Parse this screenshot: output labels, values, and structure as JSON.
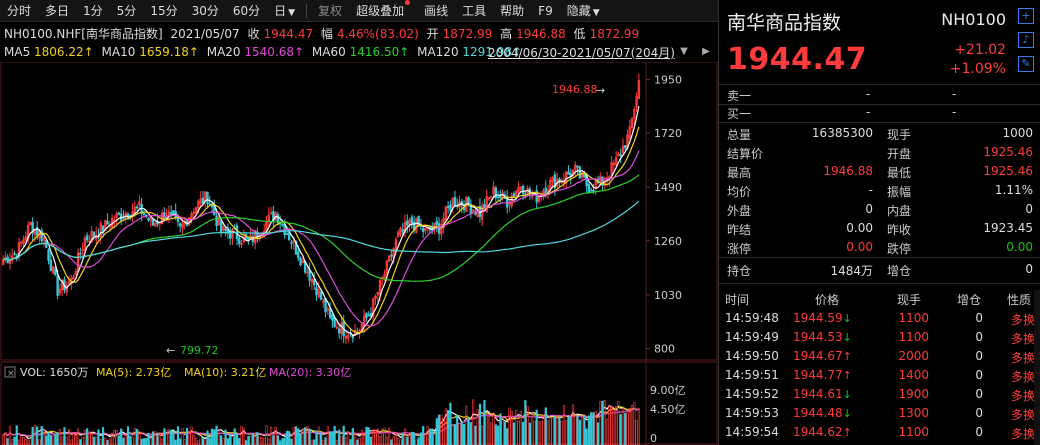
{
  "toolbar": {
    "periods": [
      "分时",
      "多日",
      "1分",
      "5分",
      "15分",
      "30分",
      "60分",
      "日"
    ],
    "restore": "复权",
    "overlay": "超级叠加",
    "draw": "画线",
    "tools": "工具",
    "help": "帮助",
    "f9": "F9",
    "hide": "隐藏"
  },
  "quote_line": {
    "symbol": "NH0100.NHF[南华商品指数]",
    "date": "2021/05/07",
    "close_label": "收",
    "close": "1944.47",
    "amp_label": "幅",
    "amp": "4.46%(83.02)",
    "open_label": "开",
    "open": "1872.99",
    "high_label": "高",
    "high": "1946.88",
    "low_label": "低",
    "low": "1872.99"
  },
  "ma_line": {
    "ma5_label": "MA5",
    "ma5": "1806.22↑",
    "ma10_label": "MA10",
    "ma10": "1659.18↑",
    "ma20_label": "MA20",
    "ma20": "1540.68↑",
    "ma60_label": "MA60",
    "ma60": "1416.50↑",
    "ma120_label": "MA120",
    "ma120": "1291.98↑",
    "range": "2004/06/30-2021/05/07(204月)"
  },
  "chart_data": {
    "type": "candlestick",
    "y_ticks": [
      1950,
      1720,
      1490,
      1260,
      1030,
      800
    ],
    "y_range": [
      760,
      1990
    ],
    "max_label": "1946.88",
    "min_label": "799.72",
    "vol_label": "VOL: 1650万",
    "vol_ma5": "MA(5): 2.73亿",
    "vol_ma10": "MA(10): 3.21亿",
    "vol_ma20": "MA(20): 3.30亿",
    "vol_ticks": [
      "9.00亿",
      "4.50亿",
      "0"
    ],
    "colors": {
      "up": "#ff3b3b",
      "down": "#37c8d8",
      "ma5": "#ffffff",
      "ma10": "#f3d21a",
      "ma20": "#e04bd7",
      "ma60": "#2bd12b",
      "ma120": "#4fd8de"
    },
    "close_anchors": [
      [
        0,
        1180
      ],
      [
        6,
        1210
      ],
      [
        12,
        1330
      ],
      [
        18,
        1270
      ],
      [
        24,
        1050
      ],
      [
        30,
        1090
      ],
      [
        36,
        1270
      ],
      [
        42,
        1300
      ],
      [
        48,
        1350
      ],
      [
        54,
        1380
      ],
      [
        60,
        1400
      ],
      [
        66,
        1330
      ],
      [
        72,
        1380
      ],
      [
        78,
        1310
      ],
      [
        84,
        1400
      ],
      [
        90,
        1450
      ],
      [
        96,
        1300
      ],
      [
        102,
        1290
      ],
      [
        108,
        1250
      ],
      [
        114,
        1320
      ],
      [
        120,
        1380
      ],
      [
        126,
        1280
      ],
      [
        132,
        1170
      ],
      [
        138,
        1060
      ],
      [
        144,
        920
      ],
      [
        150,
        880
      ],
      [
        156,
        870
      ],
      [
        162,
        960
      ],
      [
        168,
        1120
      ],
      [
        174,
        1280
      ],
      [
        180,
        1340
      ],
      [
        186,
        1300
      ],
      [
        192,
        1320
      ],
      [
        198,
        1430
      ],
      [
        204,
        1420
      ],
      [
        210,
        1380
      ],
      [
        216,
        1470
      ],
      [
        222,
        1430
      ],
      [
        228,
        1500
      ],
      [
        234,
        1440
      ],
      [
        240,
        1500
      ],
      [
        246,
        1530
      ],
      [
        252,
        1560
      ],
      [
        258,
        1490
      ],
      [
        264,
        1510
      ],
      [
        270,
        1600
      ],
      [
        276,
        1720
      ],
      [
        280,
        1944
      ]
    ]
  },
  "panel": {
    "title": "南华商品指数",
    "code": "NH0100",
    "price": "1944.47",
    "change": "+21.02",
    "pct": "+1.09%",
    "icons": [
      "plus-icon",
      "bell-icon",
      "edit-icon"
    ],
    "sell_label": "卖一",
    "buy_label": "买一",
    "dash": "-",
    "stats": [
      {
        "l1": "总量",
        "v1": "16385300",
        "l2": "现手",
        "v2": "1000",
        "c1": "w",
        "c2": "w"
      },
      {
        "l1": "结算价",
        "v1": "",
        "l2": "开盘",
        "v2": "1925.46",
        "c1": "w",
        "c2": "r"
      },
      {
        "l1": "最高",
        "v1": "1946.88",
        "l2": "最低",
        "v2": "1925.46",
        "c1": "r",
        "c2": "r"
      },
      {
        "l1": "均价",
        "v1": "-",
        "l2": "振幅",
        "v2": "1.11%",
        "c1": "w",
        "c2": "w"
      },
      {
        "l1": "外盘",
        "v1": "0",
        "l2": "内盘",
        "v2": "0",
        "c1": "w",
        "c2": "w"
      },
      {
        "l1": "昨结",
        "v1": "0.00",
        "l2": "昨收",
        "v2": "1923.45",
        "c1": "w",
        "c2": "w"
      },
      {
        "l1": "涨停",
        "v1": "0.00",
        "l2": "跌停",
        "v2": "0.00",
        "c1": "r",
        "c2": "g"
      }
    ],
    "hold_label": "持仓",
    "hold": "1484万",
    "addhold_label": "增仓",
    "addhold": "0",
    "ticks_header": {
      "time": "时间",
      "price": "价格",
      "vol": "现手",
      "add": "增仓",
      "nature": "性质"
    },
    "ticks": [
      {
        "time": "14:59:48",
        "price": "1944.59",
        "dir": "down",
        "vol": "1100",
        "add": "0",
        "nature": "多换"
      },
      {
        "time": "14:59:49",
        "price": "1944.53",
        "dir": "down",
        "vol": "1100",
        "add": "0",
        "nature": "多换"
      },
      {
        "time": "14:59:50",
        "price": "1944.67",
        "dir": "up",
        "vol": "2000",
        "add": "0",
        "nature": "多换"
      },
      {
        "time": "14:59:51",
        "price": "1944.77",
        "dir": "up",
        "vol": "1400",
        "add": "0",
        "nature": "多换"
      },
      {
        "time": "14:59:52",
        "price": "1944.61",
        "dir": "down",
        "vol": "1900",
        "add": "0",
        "nature": "多换"
      },
      {
        "time": "14:59:53",
        "price": "1944.48",
        "dir": "down",
        "vol": "1300",
        "add": "0",
        "nature": "多换"
      },
      {
        "time": "14:59:54",
        "price": "1944.62",
        "dir": "up",
        "vol": "1100",
        "add": "0",
        "nature": "多换"
      }
    ]
  }
}
